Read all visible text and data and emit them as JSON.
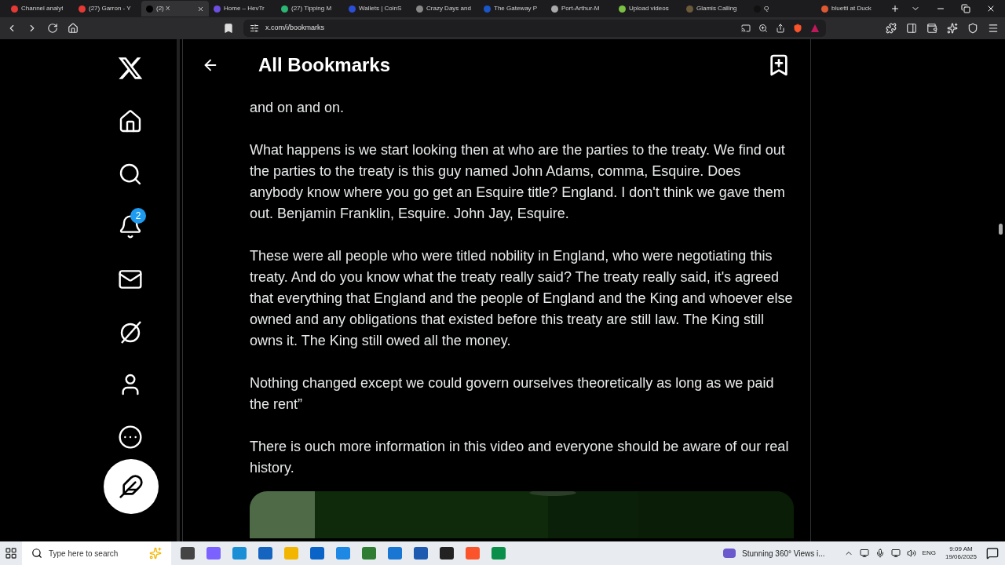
{
  "browser": {
    "tabs": [
      {
        "title": "Channel analyt",
        "selected": false,
        "color": "#e53935"
      },
      {
        "title": "(27) Garron - Y",
        "selected": false,
        "color": "#e53935"
      },
      {
        "title": "(2) X",
        "selected": true,
        "color": "#000000"
      },
      {
        "title": "Home – HevTr",
        "selected": false,
        "color": "#6c4ee0"
      },
      {
        "title": "(27) Tipping M",
        "selected": false,
        "color": "#2bb673"
      },
      {
        "title": "Wallets | CoinS",
        "selected": false,
        "color": "#2a4fd6"
      },
      {
        "title": "Crazy Days and",
        "selected": false,
        "color": "#888888"
      },
      {
        "title": "The Gateway P",
        "selected": false,
        "color": "#1a56c8"
      },
      {
        "title": "Port-Arthur-M",
        "selected": false,
        "color": "#aaaaaa"
      },
      {
        "title": "Upload videos",
        "selected": false,
        "color": "#7bc043"
      },
      {
        "title": "Glamis Calling",
        "selected": false,
        "color": "#6b5a3a"
      },
      {
        "title": "Q",
        "selected": false,
        "color": "#111111"
      },
      {
        "title": "bluetti at Duck",
        "selected": false,
        "color": "#de5833"
      }
    ],
    "url": "x.com/i/bookmarks"
  },
  "sidebar": {
    "notification_count": "2"
  },
  "header": {
    "title": "All Bookmarks"
  },
  "post": {
    "paragraphs": [
      "and on and on.",
      "What happens is we start looking then at who are the parties to the treaty. We find out the parties to the treaty is this guy named John Adams, comma, Esquire. Does anybody know where you go get an Esquire title? England. I don't think we gave them out. Benjamin Franklin, Esquire. John Jay, Esquire.",
      "These were all people who were titled nobility in England, who were negotiating this treaty. And do you know what the treaty really said? The treaty really said, it's agreed that everything that England and the people of England and the King and whoever else owned and any obligations that existed before this treaty are still law. The King still owns it. The King still owed all the money.",
      "Nothing changed except we could govern ourselves theoretically as long as we paid the rent”",
      "There is ouch more information in this video and everyone should be aware of our real history."
    ]
  },
  "taskbar": {
    "search_placeholder": "Type here to search",
    "notification": "Stunning 360° Views i...",
    "language": "ENG",
    "time": "9:09 AM",
    "date": "19/06/2025"
  }
}
